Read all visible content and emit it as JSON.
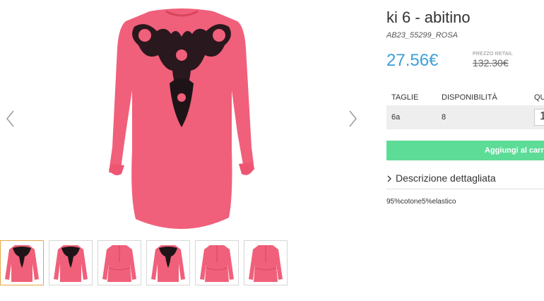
{
  "product": {
    "title": "ki 6 - abitino",
    "sku": "AB23_55299_ROSA",
    "price": "27.56€",
    "retail_label": "PREZZO RETAIL",
    "retail_price": "132.30€",
    "image_color": "#f0607a"
  },
  "sizes_table": {
    "headers": {
      "size": "TAGLIE",
      "availability": "DISPONIBILITÀ",
      "quantity": "QU"
    },
    "rows": [
      {
        "size": "6a",
        "availability": "8",
        "quantity": "1"
      }
    ]
  },
  "cart": {
    "add_label": "Aggiungi al carre",
    "color": "#5ddc97"
  },
  "description": {
    "toggle_label": "Descrizione dettagliata",
    "text": "95%cotone5%elastico"
  },
  "gallery": {
    "thumbnails": [
      {
        "variant": "front",
        "active": true
      },
      {
        "variant": "front",
        "active": false
      },
      {
        "variant": "back",
        "active": false
      },
      {
        "variant": "front",
        "active": false
      },
      {
        "variant": "back",
        "active": false
      },
      {
        "variant": "back",
        "active": false
      }
    ],
    "prev_icon": "chevron-left-icon",
    "next_icon": "chevron-right-icon"
  }
}
